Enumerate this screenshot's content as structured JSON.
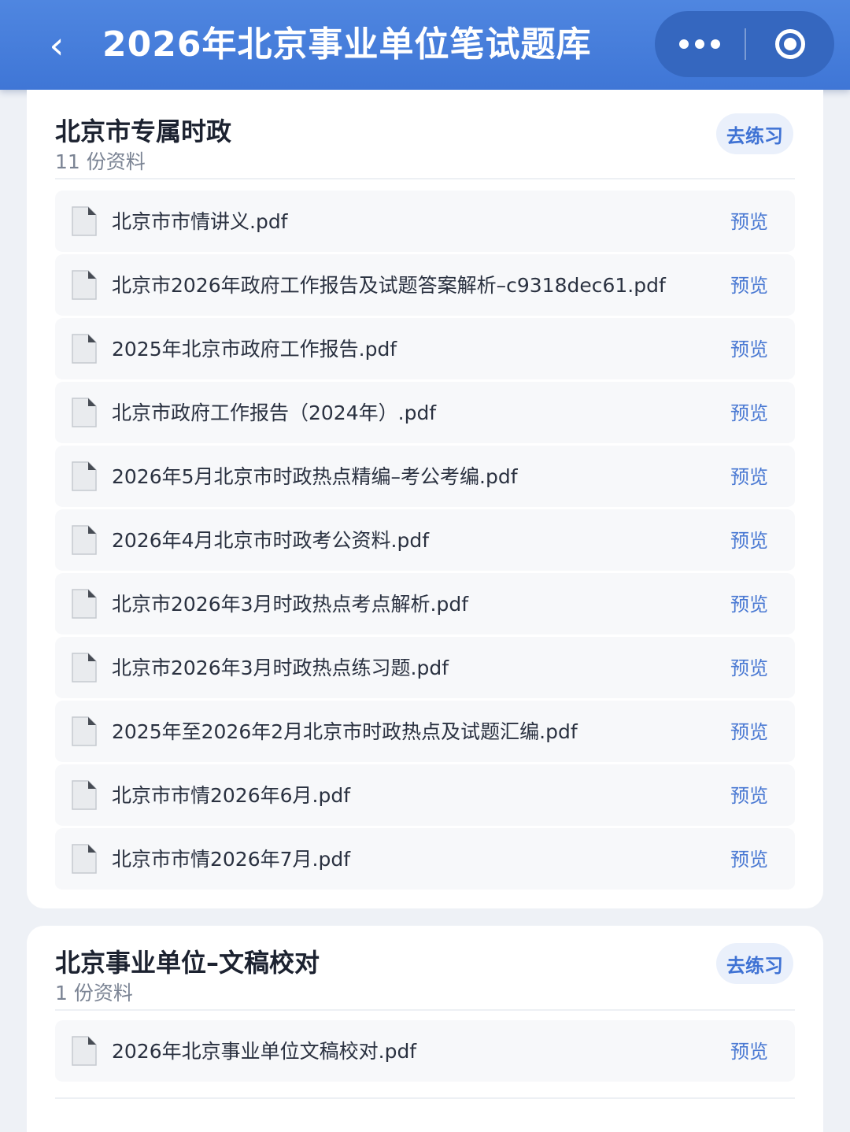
{
  "header": {
    "title": "2026年北京事业单位笔试题库",
    "back_glyph": "‹"
  },
  "sections": [
    {
      "title": "北京市专属时政",
      "count": "11 份资料",
      "practice_label": "去练习",
      "files": [
        "北京市市情讲义.pdf",
        "北京市2026年政府工作报告及试题答案解析–c9318dec61.pdf",
        "2025年北京市政府工作报告.pdf",
        "北京市政府工作报告（2024年）.pdf",
        "2026年5月北京市时政热点精编–考公考编.pdf",
        "2026年4月北京市时政考公资料.pdf",
        "北京市2026年3月时政热点考点解析.pdf",
        "北京市2026年3月时政热点练习题.pdf",
        "2025年至2026年2月北京市时政热点及试题汇编.pdf",
        "北京市市情2026年6月.pdf",
        "北京市市情2026年7月.pdf"
      ]
    },
    {
      "title": "北京事业单位–文稿校对",
      "count": "1 份资料",
      "practice_label": "去练习",
      "files": [
        "2026年北京事业单位文稿校对.pdf"
      ]
    }
  ],
  "preview_label": "预览",
  "colors": {
    "header_bg": "#4a80dc",
    "accent": "#3f72d4",
    "row_bg": "#f7f8fa"
  },
  "icons": {
    "back": "chevron-left-icon",
    "more": "more-dots-icon",
    "close": "target-icon",
    "file": "file-icon"
  }
}
